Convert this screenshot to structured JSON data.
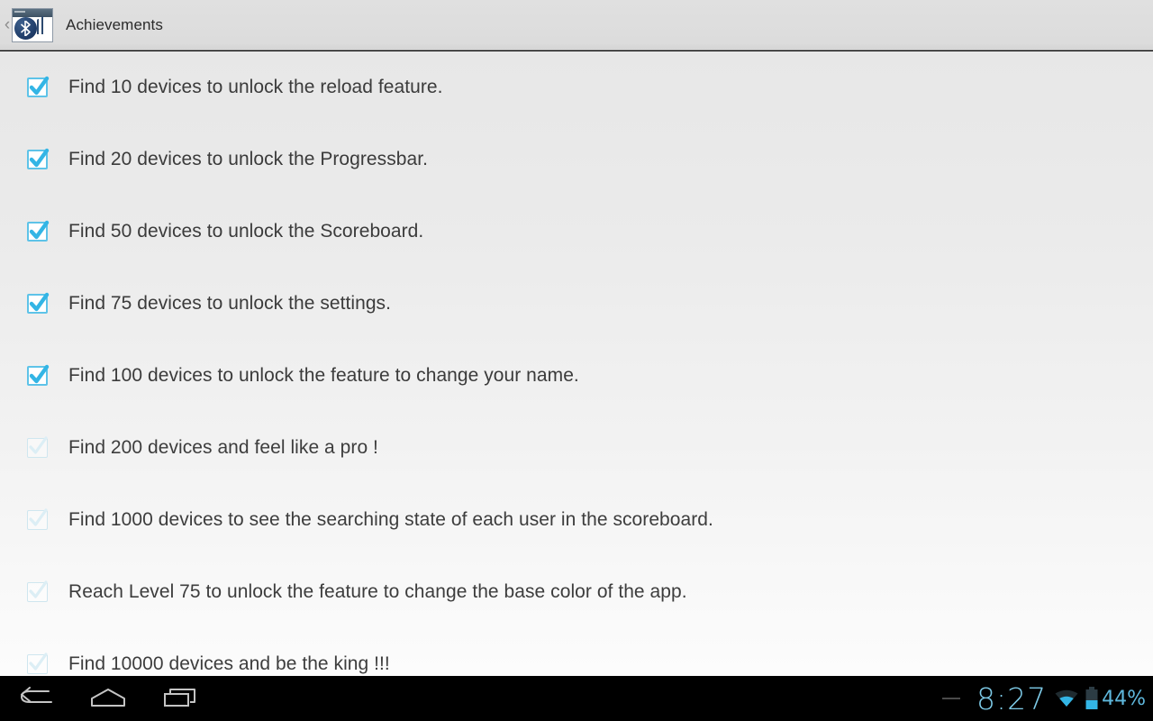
{
  "titlebar": {
    "back_label": "‹",
    "app_icon_name": "bluetooth-scanner-app-icon",
    "title": "Achievements"
  },
  "achievements": {
    "items": [
      {
        "label": "Find 10 devices to unlock the reload feature.",
        "checked": true
      },
      {
        "label": "Find 20 devices to unlock the Progressbar.",
        "checked": true
      },
      {
        "label": "Find 50 devices to unlock the Scoreboard.",
        "checked": true
      },
      {
        "label": "Find 75 devices to unlock the settings.",
        "checked": true
      },
      {
        "label": "Find 100 devices to unlock the feature to change your name.",
        "checked": true
      },
      {
        "label": "Find 200 devices and feel like a pro !",
        "checked": false
      },
      {
        "label": "Find 1000 devices to see the searching state of each user in the scoreboard.",
        "checked": false
      },
      {
        "label": "Reach Level 75 to unlock the feature to change the base color of the app.",
        "checked": false
      },
      {
        "label": "Find 10000 devices and be the king !!!",
        "checked": false
      }
    ]
  },
  "systembar": {
    "back_icon": "back-icon",
    "home_icon": "home-icon",
    "recents_icon": "recents-icon",
    "separator": "—",
    "clock": "8:27",
    "wifi_icon": "wifi-icon",
    "battery_icon": "battery-icon",
    "battery_percent": "44%"
  },
  "colors": {
    "accent_blue": "#33b5e5",
    "checkbox_border": "#5ec3e8",
    "status_blue": "#7ecbe8",
    "text": "#3b3b3b",
    "titlebar_bg": "#dcdcdc"
  }
}
